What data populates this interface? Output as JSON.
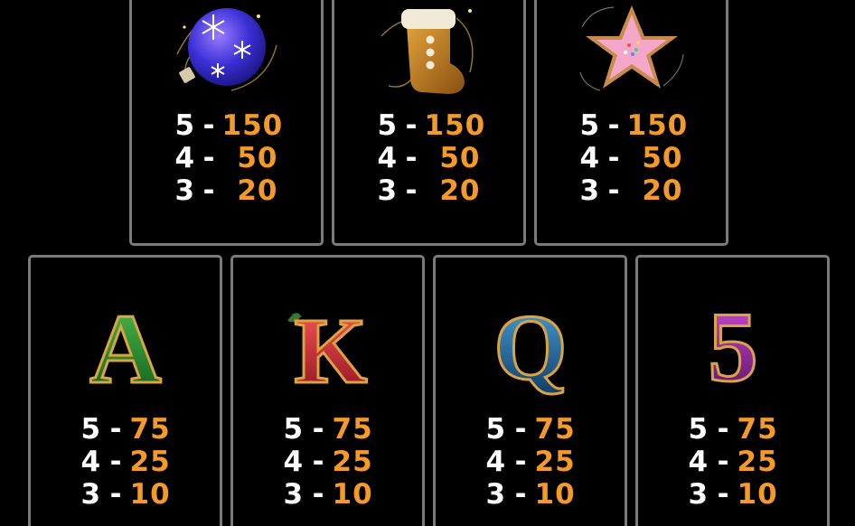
{
  "colors": {
    "background": "#000000",
    "panel_border": "#7a7a7a",
    "count_text": "#ffffff",
    "payout_text": "#f39a2a"
  },
  "paytable": {
    "top": [
      {
        "symbol_icon": "blue-ornament-icon",
        "rows": [
          {
            "count": "5",
            "dash": "-",
            "amount": "150"
          },
          {
            "count": "4",
            "dash": "-",
            "amount": "50"
          },
          {
            "count": "3",
            "dash": "-",
            "amount": "20"
          }
        ]
      },
      {
        "symbol_icon": "stocking-icon",
        "rows": [
          {
            "count": "5",
            "dash": "-",
            "amount": "150"
          },
          {
            "count": "4",
            "dash": "-",
            "amount": "50"
          },
          {
            "count": "3",
            "dash": "-",
            "amount": "20"
          }
        ]
      },
      {
        "symbol_icon": "star-cookie-icon",
        "rows": [
          {
            "count": "5",
            "dash": "-",
            "amount": "150"
          },
          {
            "count": "4",
            "dash": "-",
            "amount": "50"
          },
          {
            "count": "3",
            "dash": "-",
            "amount": "20"
          }
        ]
      }
    ],
    "bottom": [
      {
        "symbol_icon": "letter-a-icon",
        "symbol_glyph": "A",
        "rows": [
          {
            "count": "5",
            "dash": "-",
            "amount": "75"
          },
          {
            "count": "4",
            "dash": "-",
            "amount": "25"
          },
          {
            "count": "3",
            "dash": "-",
            "amount": "10"
          }
        ]
      },
      {
        "symbol_icon": "letter-k-icon",
        "symbol_glyph": "K",
        "rows": [
          {
            "count": "5",
            "dash": "-",
            "amount": "75"
          },
          {
            "count": "4",
            "dash": "-",
            "amount": "25"
          },
          {
            "count": "3",
            "dash": "-",
            "amount": "10"
          }
        ]
      },
      {
        "symbol_icon": "letter-q-icon",
        "symbol_glyph": "Q",
        "rows": [
          {
            "count": "5",
            "dash": "-",
            "amount": "75"
          },
          {
            "count": "4",
            "dash": "-",
            "amount": "25"
          },
          {
            "count": "3",
            "dash": "-",
            "amount": "10"
          }
        ]
      },
      {
        "symbol_icon": "number-5-icon",
        "symbol_glyph": "5",
        "rows": [
          {
            "count": "5",
            "dash": "-",
            "amount": "75"
          },
          {
            "count": "4",
            "dash": "-",
            "amount": "25"
          },
          {
            "count": "3",
            "dash": "-",
            "amount": "10"
          }
        ]
      }
    ]
  }
}
